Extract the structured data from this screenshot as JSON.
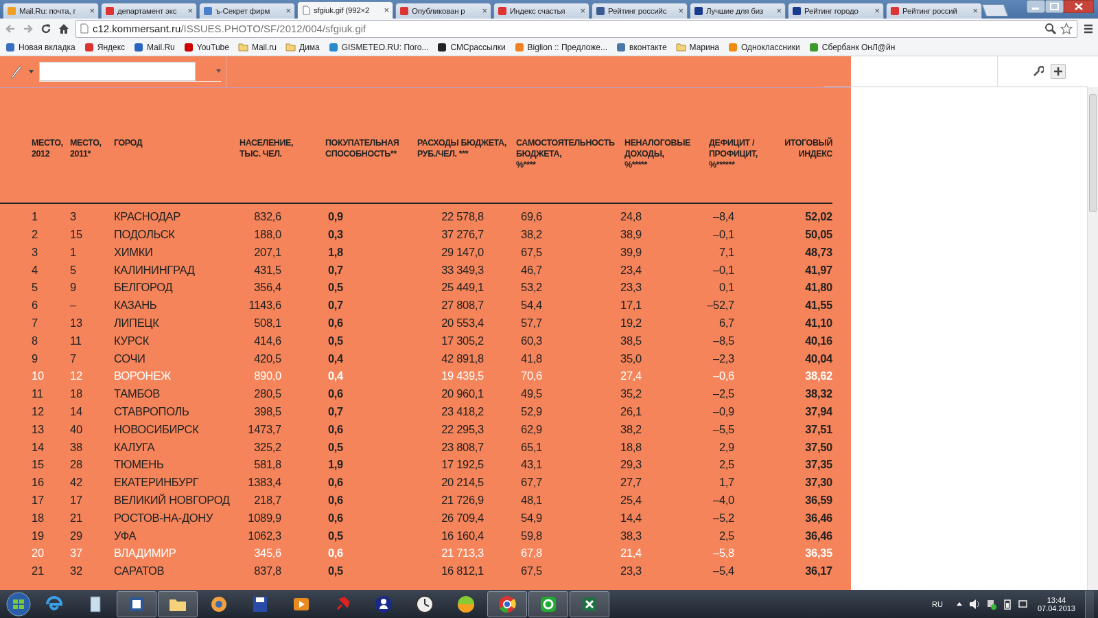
{
  "tabs": [
    {
      "title": "Mail.Ru: почта, г",
      "close": "×",
      "selected": false
    },
    {
      "title": "департамент экс",
      "close": "×",
      "selected": false
    },
    {
      "title": "ъ-Секрет фирм",
      "close": "×",
      "selected": false
    },
    {
      "title": "sfgiuk.gif (992×2",
      "close": "×",
      "selected": true
    },
    {
      "title": "Опубликован р",
      "close": "×",
      "selected": false
    },
    {
      "title": "Индекс счастья",
      "close": "×",
      "selected": false
    },
    {
      "title": "Рейтинг российс",
      "close": "×",
      "selected": false
    },
    {
      "title": "Лучшие для биз",
      "close": "×",
      "selected": false
    },
    {
      "title": "Рейтинг городо",
      "close": "×",
      "selected": false
    },
    {
      "title": "Рейтинг россий",
      "close": "×",
      "selected": false
    }
  ],
  "address": {
    "host": "c12.kommersant.ru",
    "path": "/ISSUES.PHOTO/SF/2012/004/sfgiuk.gif"
  },
  "bookmarks": [
    {
      "label": "Новая вкладка",
      "kind": "site"
    },
    {
      "label": "Яндекс",
      "kind": "site"
    },
    {
      "label": "Mail.Ru",
      "kind": "site"
    },
    {
      "label": "YouTube",
      "kind": "site"
    },
    {
      "label": "Mail.ru",
      "kind": "folder"
    },
    {
      "label": "Дима",
      "kind": "folder"
    },
    {
      "label": "GISMETEO.RU: Пого...",
      "kind": "site"
    },
    {
      "label": "СМСрассылки",
      "kind": "site"
    },
    {
      "label": "Biglion :: Предложе...",
      "kind": "site"
    },
    {
      "label": "вконтакте",
      "kind": "site"
    },
    {
      "label": "Марина",
      "kind": "folder"
    },
    {
      "label": "Одноклассники",
      "kind": "site"
    },
    {
      "label": "Сбербанк ОнЛ@йн",
      "kind": "site"
    }
  ],
  "table": {
    "columns": [
      "МЕСТО,\n2012",
      "МЕСТО,\n2011*",
      "ГОРОД",
      "НАСЕЛЕНИЕ,\nТЫС. ЧЕЛ.",
      "ПОКУПАТЕЛЬНАЯ\nСПОСОБНОСТЬ**",
      "РАСХОДЫ БЮДЖЕТА,\nРУБ./ЧЕЛ. ***",
      "САМОСТОЯТЕЛЬНОСТЬ\nБЮДЖЕТА,\n%****",
      "НЕНАЛОГОВЫЕ\nДОХОДЫ,\n%*****",
      "ДЕФИЦИТ /\nПРОФИЦИТ,\n%******",
      "ИТОГОВЫЙ\nИНДЕКС"
    ],
    "rows": [
      {
        "cells": [
          "1",
          "3",
          "КРАСНОДАР",
          "832,6",
          "0,9",
          "22 578,8",
          "69,6",
          "24,8",
          "–8,4",
          "52,02"
        ],
        "highlighted": false
      },
      {
        "cells": [
          "2",
          "15",
          "ПОДОЛЬСК",
          "188,0",
          "0,3",
          "37 276,7",
          "38,2",
          "38,9",
          "–0,1",
          "50,05"
        ],
        "highlighted": false
      },
      {
        "cells": [
          "3",
          "1",
          "ХИМКИ",
          "207,1",
          "1,8",
          "29 147,0",
          "67,5",
          "39,9",
          "7,1",
          "48,73"
        ],
        "highlighted": false
      },
      {
        "cells": [
          "4",
          "5",
          "КАЛИНИНГРАД",
          "431,5",
          "0,7",
          "33 349,3",
          "46,7",
          "23,4",
          "–0,1",
          "41,97"
        ],
        "highlighted": false
      },
      {
        "cells": [
          "5",
          "9",
          "БЕЛГОРОД",
          "356,4",
          "0,5",
          "25 449,1",
          "53,2",
          "23,3",
          "0,1",
          "41,80"
        ],
        "highlighted": false
      },
      {
        "cells": [
          "6",
          "–",
          "КАЗАНЬ",
          "1143,6",
          "0,7",
          "27 808,7",
          "54,4",
          "17,1",
          "–52,7",
          "41,55"
        ],
        "highlighted": false
      },
      {
        "cells": [
          "7",
          "13",
          "ЛИПЕЦК",
          "508,1",
          "0,6",
          "20 553,4",
          "57,7",
          "19,2",
          "6,7",
          "41,10"
        ],
        "highlighted": false
      },
      {
        "cells": [
          "8",
          "11",
          "КУРСК",
          "414,6",
          "0,5",
          "17 305,2",
          "60,3",
          "38,5",
          "–8,5",
          "40,16"
        ],
        "highlighted": false
      },
      {
        "cells": [
          "9",
          "7",
          "СОЧИ",
          "420,5",
          "0,4",
          "42 891,8",
          "41,8",
          "35,0",
          "–2,3",
          "40,04"
        ],
        "highlighted": false
      },
      {
        "cells": [
          "10",
          "12",
          "ВОРОНЕЖ",
          "890,0",
          "0,4",
          "19 439,5",
          "70,6",
          "27,4",
          "–0,6",
          "38,62"
        ],
        "highlighted": true
      },
      {
        "cells": [
          "11",
          "18",
          "ТАМБОВ",
          "280,5",
          "0,6",
          "20 960,1",
          "49,5",
          "35,2",
          "–2,5",
          "38,32"
        ],
        "highlighted": false
      },
      {
        "cells": [
          "12",
          "14",
          "СТАВРОПОЛЬ",
          "398,5",
          "0,7",
          "23 418,2",
          "52,9",
          "26,1",
          "–0,9",
          "37,94"
        ],
        "highlighted": false
      },
      {
        "cells": [
          "13",
          "40",
          "НОВОСИБИРСК",
          "1473,7",
          "0,6",
          "22 295,3",
          "62,9",
          "38,2",
          "–5,5",
          "37,51"
        ],
        "highlighted": false
      },
      {
        "cells": [
          "14",
          "38",
          "КАЛУГА",
          "325,2",
          "0,5",
          "23 808,7",
          "65,1",
          "18,8",
          "2,9",
          "37,50"
        ],
        "highlighted": false
      },
      {
        "cells": [
          "15",
          "28",
          "ТЮМЕНЬ",
          "581,8",
          "1,9",
          "17 192,5",
          "43,1",
          "29,3",
          "2,5",
          "37,35"
        ],
        "highlighted": false
      },
      {
        "cells": [
          "16",
          "42",
          "ЕКАТЕРИНБУРГ",
          "1383,4",
          "0,6",
          "20 214,5",
          "67,7",
          "27,7",
          "1,7",
          "37,30"
        ],
        "highlighted": false
      },
      {
        "cells": [
          "17",
          "17",
          "ВЕЛИКИЙ НОВГОРОД",
          "218,7",
          "0,6",
          "21 726,9",
          "48,1",
          "25,4",
          "–4,0",
          "36,59"
        ],
        "highlighted": false
      },
      {
        "cells": [
          "18",
          "21",
          "РОСТОВ-НА-ДОНУ",
          "1089,9",
          "0,6",
          "26 709,4",
          "54,9",
          "14,4",
          "–5,2",
          "36,46"
        ],
        "highlighted": false
      },
      {
        "cells": [
          "19",
          "29",
          "УФА",
          "1062,3",
          "0,5",
          "16 160,4",
          "59,8",
          "38,3",
          "2,5",
          "36,46"
        ],
        "highlighted": false
      },
      {
        "cells": [
          "20",
          "37",
          "ВЛАДИМИР",
          "345,6",
          "0,6",
          "21 713,3",
          "67,8",
          "21,4",
          "–5,8",
          "36,35"
        ],
        "highlighted": true
      },
      {
        "cells": [
          "21",
          "32",
          "САРАТОВ",
          "837,8",
          "0,5",
          "16 812,1",
          "67,5",
          "23,3",
          "–5,4",
          "36,17"
        ],
        "highlighted": false
      }
    ]
  },
  "taskbar": {
    "apps": [
      {
        "kind": "ie",
        "selected": false
      },
      {
        "kind": "calc",
        "selected": false
      },
      {
        "kind": "word",
        "selected": true
      },
      {
        "kind": "folder",
        "selected": true
      },
      {
        "kind": "eye",
        "selected": false
      },
      {
        "kind": "disk",
        "selected": false
      },
      {
        "kind": "play",
        "selected": false
      },
      {
        "kind": "pin",
        "selected": false
      },
      {
        "kind": "person",
        "selected": false
      },
      {
        "kind": "clock",
        "selected": false
      },
      {
        "kind": "ball",
        "selected": false
      },
      {
        "kind": "chrome",
        "selected": true
      },
      {
        "kind": "at",
        "selected": true
      },
      {
        "kind": "excel",
        "selected": true
      }
    ],
    "language": "RU",
    "time": "13:44",
    "date": "07.04.2013"
  }
}
